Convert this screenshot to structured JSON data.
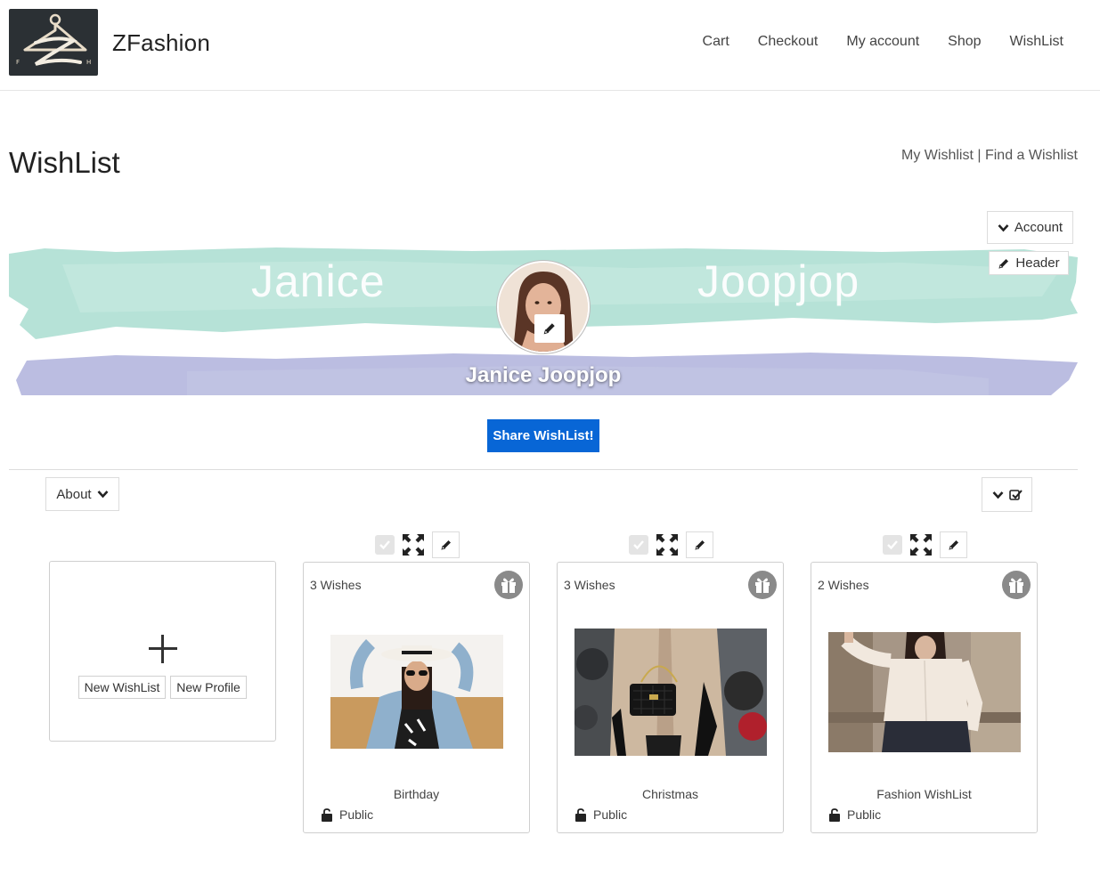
{
  "header": {
    "brand": "ZFashion",
    "logo_letters": [
      "F",
      "H"
    ],
    "nav": [
      "Cart",
      "Checkout",
      "My account",
      "Shop",
      "WishList"
    ]
  },
  "page": {
    "title": "WishList",
    "links": {
      "my": "My Wishlist",
      "separator": "|",
      "find": "Find a Wishlist"
    }
  },
  "controls": {
    "account": "Account",
    "header": "Header",
    "about": "About"
  },
  "banner": {
    "first_name": "Janice",
    "last_name": "Joopjop",
    "full_name": "Janice Joopjop"
  },
  "share_label": "Share WishList!",
  "new_card": {
    "new_wishlist": "New WishList",
    "new_profile": "New Profile"
  },
  "wishlists": [
    {
      "count": "3 Wishes",
      "title": "Birthday",
      "privacy": "Public"
    },
    {
      "count": "3 Wishes",
      "title": "Christmas",
      "privacy": "Public"
    },
    {
      "count": "2 Wishes",
      "title": "Fashion WishList",
      "privacy": "Public"
    }
  ],
  "colors": {
    "primary": "#0866d6",
    "banner_teal": "#a9ddd0",
    "banner_lavender": "#b4b6de"
  }
}
